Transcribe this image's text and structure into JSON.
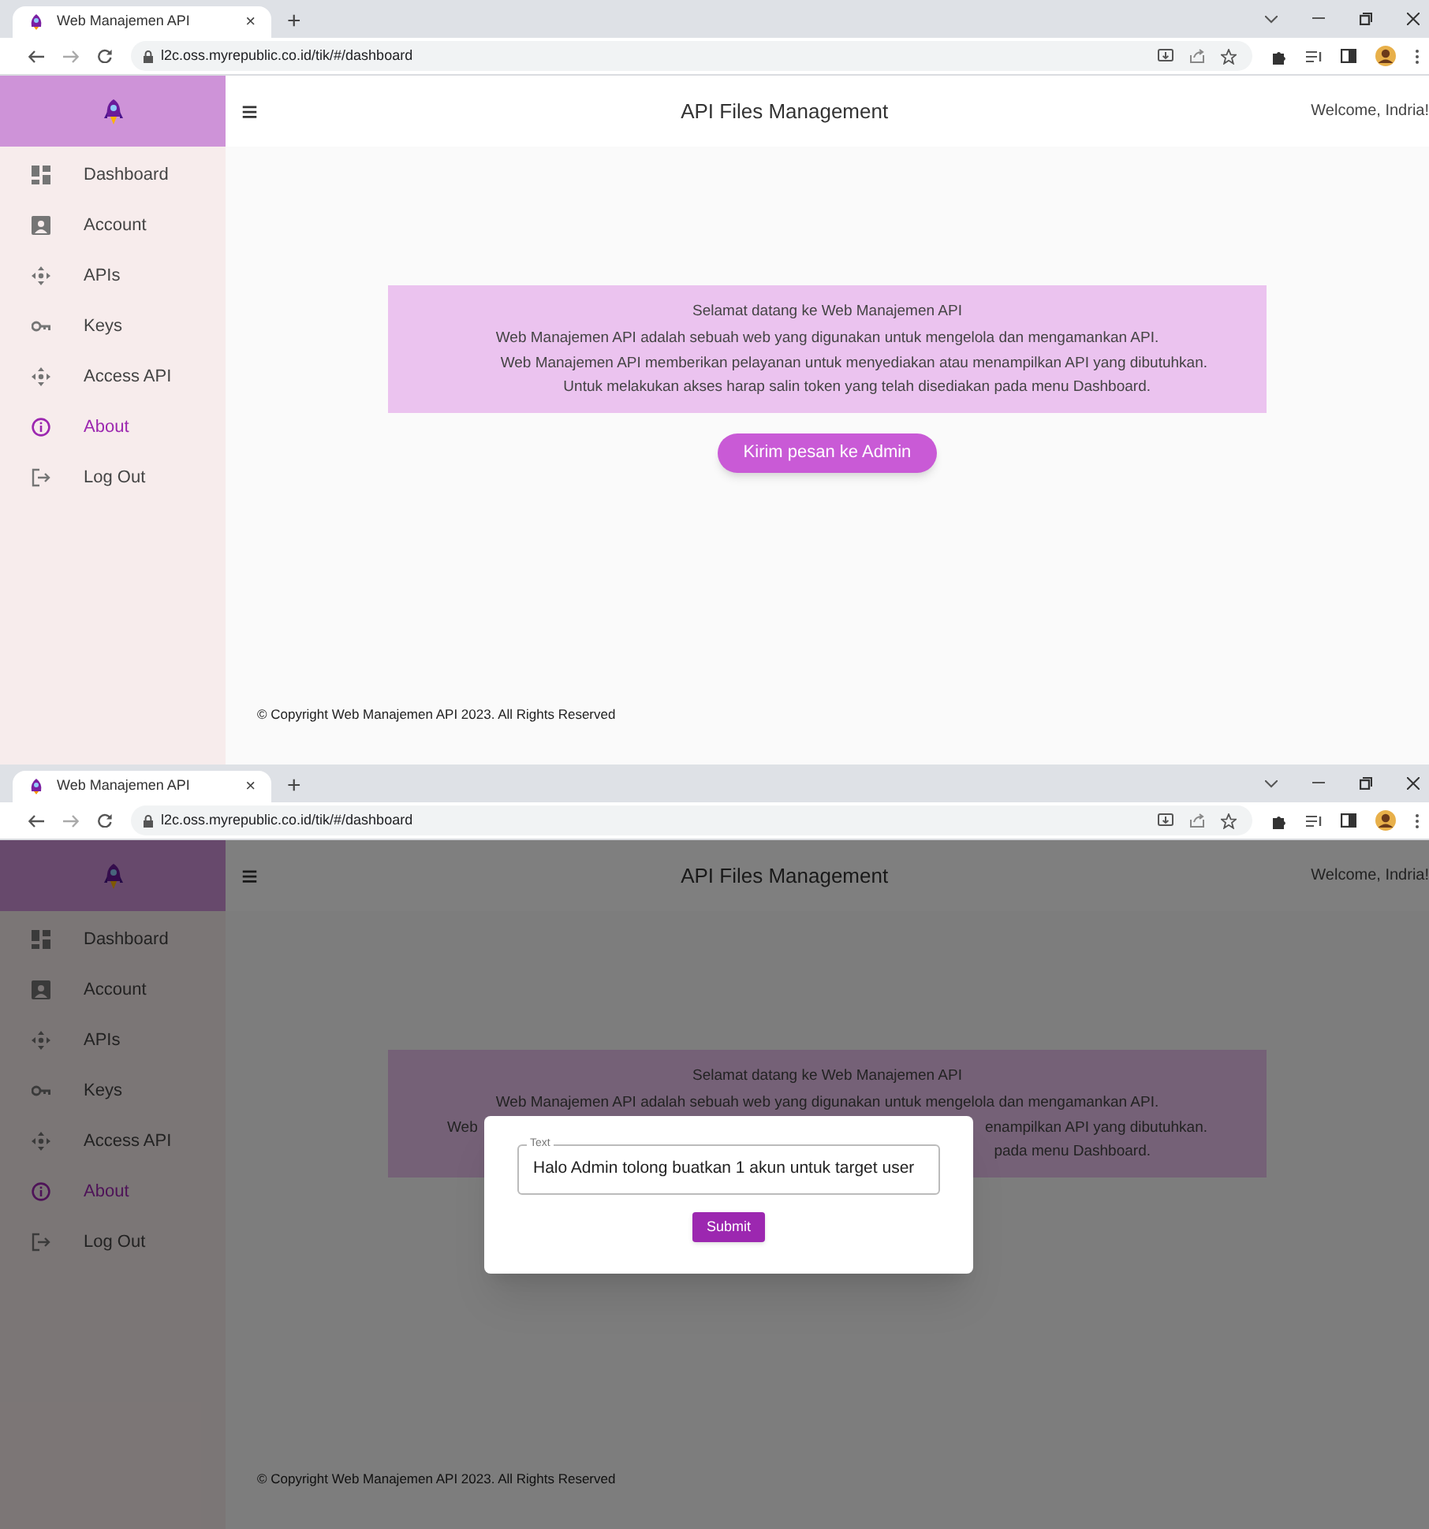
{
  "screens": [
    {
      "browser": {
        "tab_title": "Web Manajemen API",
        "tab_close": "×",
        "new_tab": "+",
        "address": "l2c.oss.myrepublic.co.id/tik/#/dashboard"
      },
      "sidebar": {
        "items": [
          {
            "label": "Dashboard",
            "selected": false
          },
          {
            "label": "Account",
            "selected": false
          },
          {
            "label": "APIs",
            "selected": false
          },
          {
            "label": "Keys",
            "selected": false
          },
          {
            "label": "Access API",
            "selected": false
          },
          {
            "label": "About",
            "selected": true
          },
          {
            "label": "Log Out",
            "selected": false
          }
        ]
      },
      "header": {
        "menu": "≡",
        "title": "API Files Management",
        "welcome": "Welcome, Indria!"
      },
      "info": {
        "lines": [
          {
            "parts": [
              "Selamat datang ke Web Manajemen API"
            ]
          },
          {
            "parts": [
              "Web Manajemen API adalah sebuah web yang digunakan untuk mengelola dan mengamankan API."
            ]
          },
          {
            "parts": [
              "Web Manajemen API memberikan pelayanan untuk menyediakan atau menampilkan API yang dibutuhkan."
            ]
          },
          {
            "parts": [
              "Untuk melakukan akses harap salin token yang telah disediakan pada menu Dashboard."
            ]
          }
        ]
      },
      "action_button": "Kirim pesan ke Admin",
      "footer": "© Copyright Web Manajemen API 2023. All Rights Reserved"
    },
    {
      "browser": {
        "tab_title": "Web Manajemen API",
        "tab_close": "×",
        "new_tab": "+",
        "address": "l2c.oss.myrepublic.co.id/tik/#/dashboard"
      },
      "sidebar": {
        "items": [
          {
            "label": "Dashboard",
            "selected": false
          },
          {
            "label": "Account",
            "selected": false
          },
          {
            "label": "APIs",
            "selected": false
          },
          {
            "label": "Keys",
            "selected": false
          },
          {
            "label": "Access API",
            "selected": false
          },
          {
            "label": "About",
            "selected": true
          },
          {
            "label": "Log Out",
            "selected": false
          }
        ]
      },
      "header": {
        "menu": "≡",
        "title": "API Files Management",
        "welcome": "Welcome, Indria!"
      },
      "info": {
        "lines": [
          {
            "parts": [
              "Selamat datang ke Web Manajemen API"
            ]
          },
          {
            "parts": [
              "Web Manajemen API adalah sebuah web yang digunakan untuk mengelola dan mengamankan API."
            ]
          },
          {
            "parts": [
              "Web",
              "enampilkan API yang dibutuhkan."
            ]
          },
          {
            "parts": [
              "pada menu Dashboard."
            ]
          }
        ]
      },
      "footer": "© Copyright Web Manajemen API 2023. All Rights Reserved",
      "dialog": {
        "field_label": "Text",
        "field_value": "Halo Admin tolong buatkan 1 akun untuk target user",
        "submit": "Submit"
      }
    }
  ]
}
